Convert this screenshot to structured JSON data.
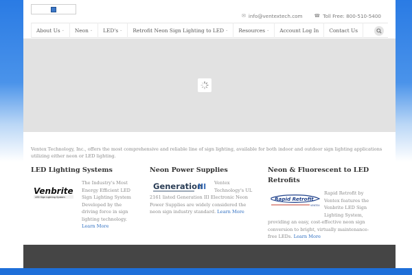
{
  "header": {
    "email": "info@ventextech.com",
    "phone": "Toll Free: 800-510-5400"
  },
  "nav": {
    "items": [
      {
        "label": "About Us",
        "has_dropdown": true
      },
      {
        "label": "Neon",
        "has_dropdown": true
      },
      {
        "label": "LED's",
        "has_dropdown": true
      },
      {
        "label": "Retrofit Neon Sign Lighting to LED",
        "has_dropdown": true
      },
      {
        "label": "Resources",
        "has_dropdown": true
      },
      {
        "label": "Account Log In",
        "has_dropdown": false
      },
      {
        "label": "Contact Us",
        "has_dropdown": false
      }
    ],
    "dropdown_glyph": "⌄"
  },
  "intro": "Ventex Technology, Inc., offers the most comprehensive and reliable line of sign lighting, available for both indoor and outdoor sign lighting applications utilizing either neon or LED lighting.",
  "columns": [
    {
      "title": "LED Lighting Systems",
      "logo": {
        "name": "Venbrite",
        "tagline": "LED Sign Lighting System"
      },
      "text": "The Industry's Most Energy Efficient LED Sign Lighting System Developed by the driving force in sign lighting technology.",
      "link": "Learn More"
    },
    {
      "title": "Neon Power Supplies",
      "logo": {
        "name": "Generation",
        "numeral": "III"
      },
      "text": "Ventex Technology's UL 2161 listed Generation III Electronic Neon Power Supplies are widely considered the neon sign industry standard.",
      "link": "Learn More"
    },
    {
      "title": "Neon & Fluorescent to LED Retrofits",
      "logo": {
        "name": "Rapid Retrofit",
        "maker": "VENTEX"
      },
      "text": "Rapid Retrofit by Ventex features the Venbrite LED Sign Lighting System, providing an easy, cost-effective neon sign conversion to bright, virtually maintenance-free LEDs.",
      "link": "Learn More"
    }
  ],
  "colors": {
    "accent_link": "#2f6fc1",
    "background_blue": "#2a7be4",
    "footer": "#454545"
  }
}
